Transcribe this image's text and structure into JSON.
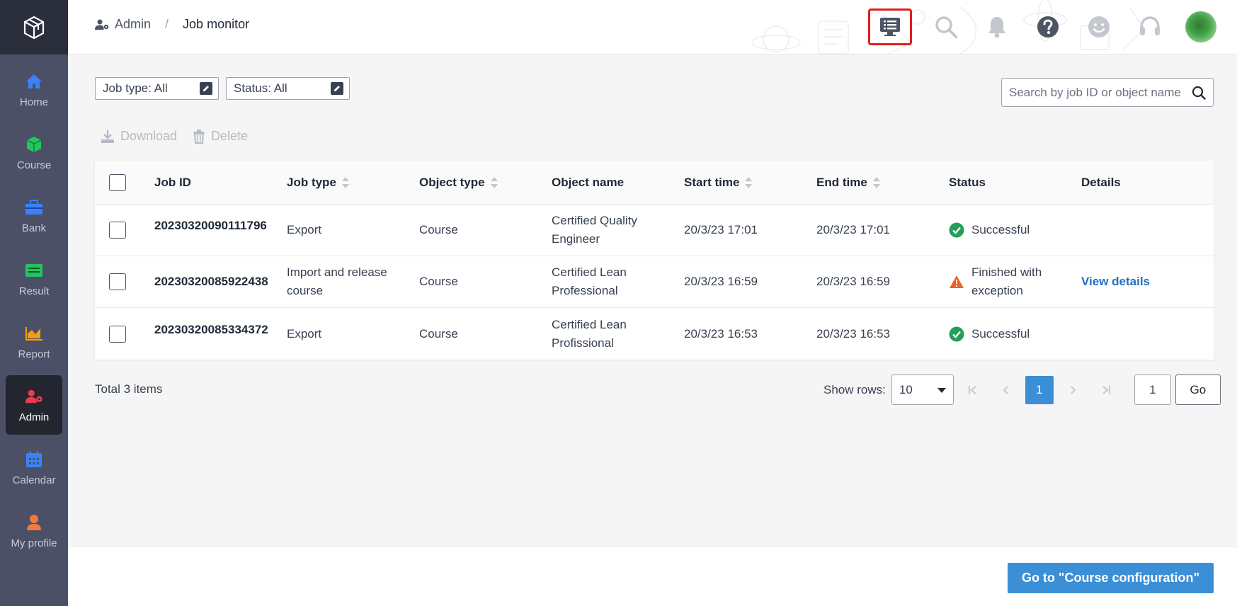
{
  "colors": {
    "accent": "#3b8fd6",
    "sidebar_bg": "#4b5067",
    "sidebar_active_bg": "#23252f",
    "success": "#22a05a",
    "warning": "#e8632a",
    "link": "#1f6fc5",
    "highlight_border": "#e11d1d"
  },
  "sidebar": {
    "logo": "app-logo",
    "items": [
      {
        "label": "Home",
        "icon": "home-icon",
        "color": "#3b82f6"
      },
      {
        "label": "Course",
        "icon": "cube-icon",
        "color": "#22c55e"
      },
      {
        "label": "Bank",
        "icon": "briefcase-icon",
        "color": "#3b82f6"
      },
      {
        "label": "Result",
        "icon": "list-card-icon",
        "color": "#22c55e"
      },
      {
        "label": "Report",
        "icon": "area-chart-icon",
        "color": "#f59e0b"
      },
      {
        "label": "Admin",
        "icon": "user-gear-icon",
        "color": "#ef3b4b",
        "active": true
      },
      {
        "label": "Calendar",
        "icon": "calendar-icon",
        "color": "#3b82f6"
      },
      {
        "label": "My profile",
        "icon": "user-icon",
        "color": "#f07a3a"
      }
    ]
  },
  "header": {
    "breadcrumb": {
      "parent": "Admin",
      "separator": "/",
      "current": "Job monitor"
    },
    "icons": [
      "job-monitor-icon",
      "search-icon",
      "bell-icon",
      "help-icon",
      "smiley-icon",
      "headset-icon",
      "avatar"
    ]
  },
  "filters": {
    "job_type": "Job type: All",
    "status": "Status: All"
  },
  "search": {
    "placeholder": "Search by job ID or object name"
  },
  "actions": {
    "download": "Download",
    "delete": "Delete"
  },
  "table": {
    "headers": {
      "job_id": "Job ID",
      "job_type": "Job type",
      "object_type": "Object type",
      "object_name": "Object name",
      "start_time": "Start time",
      "end_time": "End time",
      "status": "Status",
      "details": "Details"
    },
    "rows": [
      {
        "job_id": "20230320090111796",
        "job_type": "Export",
        "object_type": "Course",
        "object_name": "Certified Quality Engineer",
        "start_time": "20/3/23 17:01",
        "end_time": "20/3/23 17:01",
        "status": "Successful",
        "status_kind": "success",
        "details": ""
      },
      {
        "job_id": "20230320085922438",
        "job_type": "Import and release course",
        "object_type": "Course",
        "object_name": "Certified Lean Professional",
        "start_time": "20/3/23 16:59",
        "end_time": "20/3/23 16:59",
        "status": "Finished with exception",
        "status_kind": "warning",
        "details": "View details"
      },
      {
        "job_id": "20230320085334372",
        "job_type": "Export",
        "object_type": "Course",
        "object_name": "Certified Lean Profissional",
        "start_time": "20/3/23 16:53",
        "end_time": "20/3/23 16:53",
        "status": "Successful",
        "status_kind": "success",
        "details": ""
      }
    ]
  },
  "pagination": {
    "total": "Total 3 items",
    "show_rows_label": "Show rows:",
    "rows_value": "10",
    "current_page": "1",
    "goto_value": "1",
    "go_label": "Go"
  },
  "footer": {
    "cta": "Go to \"Course configuration\""
  }
}
